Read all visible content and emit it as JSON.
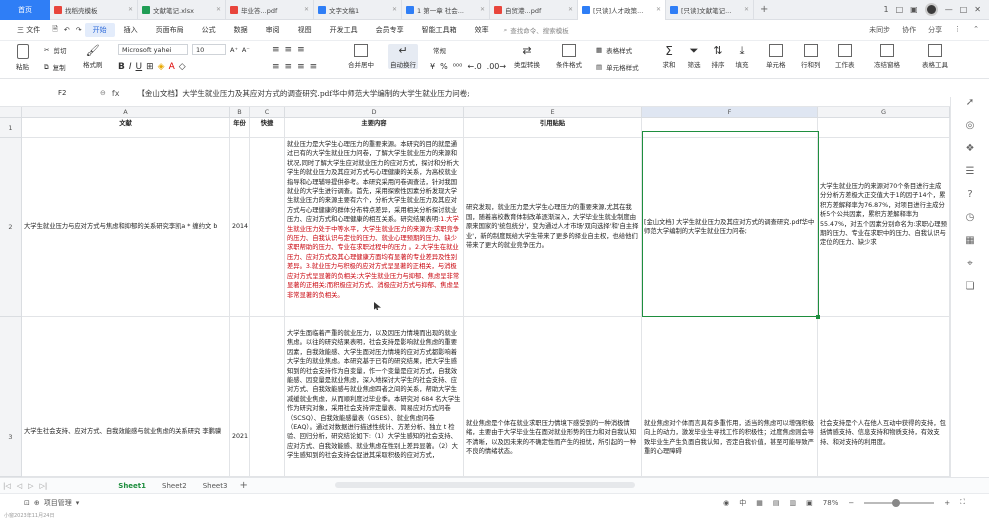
{
  "titlebar": {
    "home": "首页",
    "tabs": [
      {
        "label": "找稻壳模板",
        "color": "#e8453c",
        "active": false
      },
      {
        "label": "文献笔记.xlsx",
        "color": "#1f9d55",
        "active": false
      },
      {
        "label": "毕业答...pdf",
        "color": "#e8453c",
        "active": false
      },
      {
        "label": "文字文稿1",
        "color": "#2f7ef6",
        "active": false
      },
      {
        "label": "1 第一章 社会...",
        "color": "#2f7ef6",
        "active": false
      },
      {
        "label": "自贸港...pdf",
        "color": "#e8453c",
        "active": false
      },
      {
        "label": "[只读]人才政策...",
        "color": "#2f7ef6",
        "active": true
      },
      {
        "label": "[只读]文献笔记...",
        "color": "#2f7ef6",
        "active": false
      }
    ],
    "plus": "+",
    "right_icons": [
      "1",
      "□",
      "▣"
    ]
  },
  "menubar": {
    "file": "三 文件",
    "items": [
      "开始",
      "插入",
      "页面布局",
      "公式",
      "数据",
      "审阅",
      "视图",
      "开发工具",
      "会员专享",
      "智能工具箱",
      "效率"
    ],
    "active": "开始",
    "search_placeholder": "查找命令、搜索模板",
    "right": [
      "未同步",
      "协作",
      "分享"
    ]
  },
  "ribbon": {
    "paste": "粘贴",
    "cut": "剪切",
    "copy": "复制",
    "format_painter": "格式刷",
    "font_name": "Microsoft yahei",
    "font_size": "10",
    "merge": "合并居中",
    "wrap": "自动换行",
    "number_format": "常规",
    "type_convert": "类型转换",
    "cond_format": "条件格式",
    "table_style": "表格样式",
    "cell_style": "单元格样式",
    "sum": "求和",
    "filter": "筛选",
    "sort": "排序",
    "fill": "填充",
    "cells": "单元格",
    "rowcol": "行和列",
    "worksheet": "工作表",
    "freeze": "冻结窗格",
    "tools": "表格工具"
  },
  "formulabar": {
    "name_box": "F2",
    "fx": "fx",
    "content": "【金山文档】大学生就业压力及其应对方式的调查研究.pdf华中师范大学编制的大学生就业压力问卷;"
  },
  "grid": {
    "columns": [
      "A",
      "B",
      "C",
      "D",
      "E",
      "F",
      "G"
    ],
    "headers": [
      "文献",
      "年份",
      "快捷",
      "主要内容",
      "引用贴贴",
      "",
      ""
    ],
    "rows": [
      {
        "num": "2",
        "a": "大学生就业压力与应对方式与焦虑和抑郁的关系研究李凯a * 缠约文 b",
        "b": "2014",
        "d_black": "就业压力是大学生心理压力的重要来源。本研究的目的就是通过已有的大学生就业压力问卷，了解大学生就业压力的来源和状况,同时了解大学生应对就业压力的应对方式，探讨和分析大学生的就业压力及其应对方式与心理健康的关系，为高校就业指导和心理辅导提供参考。本研究采用问卷调查法，针对我国就业的大学生进行调查。首先，采用探索性因素分析发现大学生就业压力的来源主要有六个，分析大学生就业压力及其应对方式与心理健康的群体分布特点差异，采用相关分析探讨就业压力、应对方式和心理健康的相互关系。研究结果表明:",
        "d_red": "1.大学生就业压力处于中等水平，大学生就业压力的来源为:求职竞争的压力、自我认识与定位的压力、就业心理预期的压力、缺少求职帮助的压力、专业在求职过程中的压力 。2.大学生在就业压力、应对方式及其心理健康方面均有显著的专业差异及性别差异。3.就业压力与积极的应对方式呈显著的正相关，与消极应对方式呈显著的负相关;大学生就业压力与抑郁、焦虑呈非常显著的正相关;而积极应对方式、消极应对方式与抑郁、焦虑呈非常显著的负相关。",
        "e": "研究发现，就业压力是大学生心理压力的重要来源,尤其在我国，随着高校教育体制改革逐渐深入，大学毕业生就业制度由原来国家的'统包统分'，变为通过人才市场'双向选择'和'自主择业'，新的制度既给大学生带来了更多的择业自主权，也给他们带来了更大的就业竞争压力。",
        "f": "[金山文档] 大学生就业压力及其应对方式的调查研究.pdf华中师范大学编制的大学生就业压力问卷;",
        "g": "大学生就业压力的来源对70个条目进行主成分分析方差极大正交值大于1的因子14个，累积方差解释率为76.87%，对项目进行主成分析5个公共因素，累积方差解释率为55.47%，对五个因素分别命名为:求职心理预期的压力、专业在求职中的压力、自我认识与定位的压力、缺少求"
      },
      {
        "num": "3",
        "a": "大学生社会支持、应对方式、自我效能感与就业焦虑的关系研究 李鹏骥",
        "b": "2021",
        "d_black": "大学生面临着严重的就业压力，以及因压力情境而出现的就业焦虑。以往的研究结果表明，社会支持是影响就业焦虑的重要因素，自我效能感、大学生面对压力情境的应对方式都影响着大学生的就业焦虑。本研究基于已有的研究结果，把大学生感知到的社会支持作为自变量，作一个变量是应对方式，自我效能感、因变量是就业焦虑，深入地探讨大学生的社会支持、应对方式、自我效能感与就业焦虑四者之间的关系，帮助大学生减缓就业焦虑，从而顺利度过毕业季。本研究对 684 名大学生作为研究对象，采用社会支持评定量表、简易应对方式问卷（SCSQ）、自我效能感量表（GSES）、就业焦虑问卷（EAQ）。通过对数据进行描述性统计、方差分析、独立 t 检验、回归分析，研究结论如下:（1）大学生感知的社会支持、应对方式、自我效能感、就业焦虑在性别上差异显著。（2）大学生感知到的社会支持会促进其采取积极的应对方式，",
        "e": "就业焦虑是个体在就业求职压力情境下感受到的一种消极情绪，主要由于大学毕业生在面对就业形势的压力和对自我认知不清晰，以及因未来的不确定性而产生的担忧，所引起的一种不良的情绪状态。",
        "f": "就业焦虑对个体而言具有多重作用，适当的焦虑可以增强积极向上的动力，激发毕业生寻找工作的积极性；过度焦虑则会导致毕业生产生负面自我认知，否定自我价值，甚至可能导致严重的心理障碍",
        "g": "社会支持是个人在他人互动中获得的支持，包括情感支持、信息支持和物质支持，有效支持、和对支持的利用度。"
      }
    ]
  },
  "sheets": [
    "Sheet1",
    "Sheet2",
    "Sheet3"
  ],
  "active_sheet": "Sheet1",
  "statusbar": {
    "project": "项目管理",
    "zoom": "78%",
    "lang": "中"
  },
  "footer_note": "小窗2023年11月24日"
}
